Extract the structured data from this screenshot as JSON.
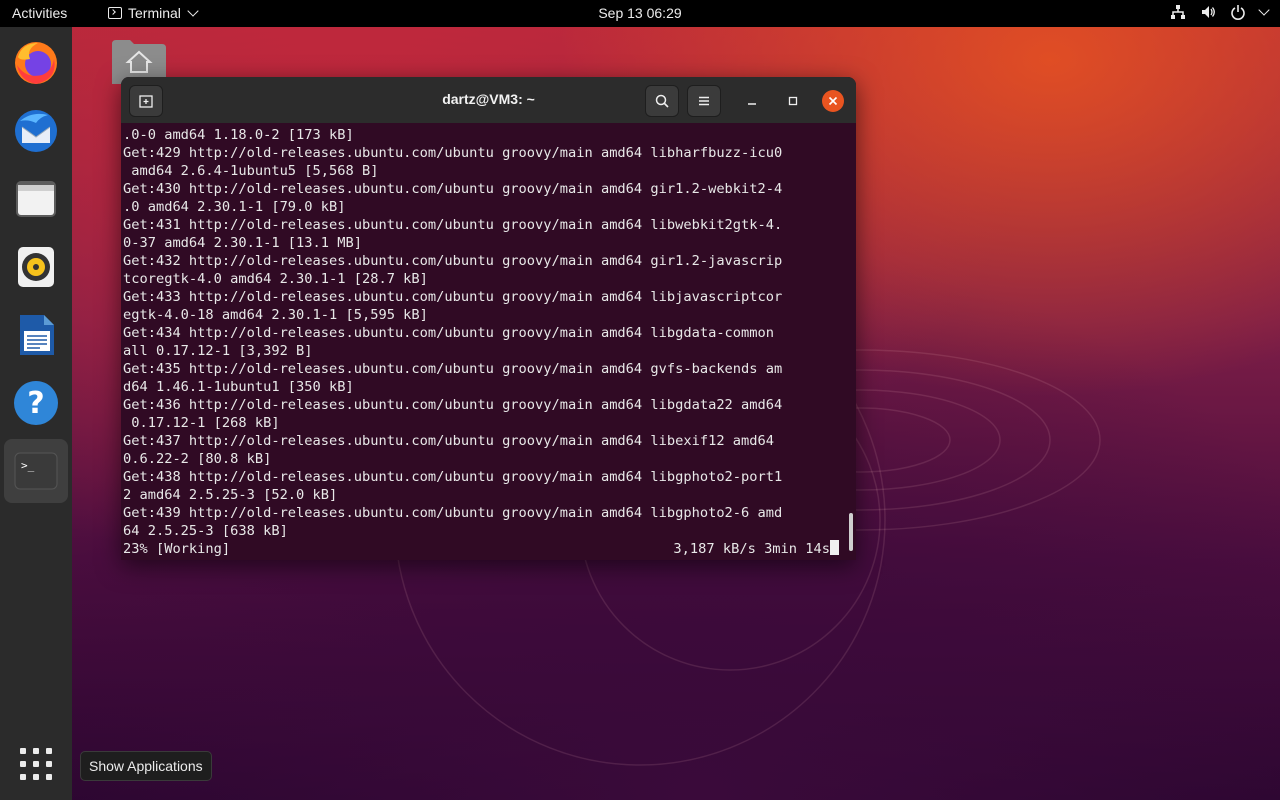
{
  "topbar": {
    "activities": "Activities",
    "app_menu": "Terminal",
    "clock": "Sep 13  06:29"
  },
  "dock": {
    "items": [
      {
        "name": "firefox",
        "icon": "firefox-icon"
      },
      {
        "name": "thunderbird",
        "icon": "thunderbird-icon"
      },
      {
        "name": "files",
        "icon": "files-icon"
      },
      {
        "name": "rhythmbox",
        "icon": "rhythmbox-icon"
      },
      {
        "name": "libreoffice-writer",
        "icon": "writer-icon"
      },
      {
        "name": "help",
        "icon": "help-icon"
      },
      {
        "name": "terminal",
        "icon": "terminal-icon",
        "active": true
      }
    ],
    "show_apps_tooltip": "Show Applications"
  },
  "terminal": {
    "title": "dartz@VM3: ~",
    "lines": [
      ".0-0 amd64 1.18.0-2 [173 kB]",
      "Get:429 http://old-releases.ubuntu.com/ubuntu groovy/main amd64 libharfbuzz-icu0",
      " amd64 2.6.4-1ubuntu5 [5,568 B]",
      "Get:430 http://old-releases.ubuntu.com/ubuntu groovy/main amd64 gir1.2-webkit2-4",
      ".0 amd64 2.30.1-1 [79.0 kB]",
      "Get:431 http://old-releases.ubuntu.com/ubuntu groovy/main amd64 libwebkit2gtk-4.",
      "0-37 amd64 2.30.1-1 [13.1 MB]",
      "Get:432 http://old-releases.ubuntu.com/ubuntu groovy/main amd64 gir1.2-javascrip",
      "tcoregtk-4.0 amd64 2.30.1-1 [28.7 kB]",
      "Get:433 http://old-releases.ubuntu.com/ubuntu groovy/main amd64 libjavascriptcor",
      "egtk-4.0-18 amd64 2.30.1-1 [5,595 kB]",
      "Get:434 http://old-releases.ubuntu.com/ubuntu groovy/main amd64 libgdata-common",
      "all 0.17.12-1 [3,392 B]",
      "Get:435 http://old-releases.ubuntu.com/ubuntu groovy/main amd64 gvfs-backends am",
      "d64 1.46.1-1ubuntu1 [350 kB]",
      "Get:436 http://old-releases.ubuntu.com/ubuntu groovy/main amd64 libgdata22 amd64",
      " 0.17.12-1 [268 kB]",
      "Get:437 http://old-releases.ubuntu.com/ubuntu groovy/main amd64 libexif12 amd64",
      "0.6.22-2 [80.8 kB]",
      "Get:438 http://old-releases.ubuntu.com/ubuntu groovy/main amd64 libgphoto2-port1",
      "2 amd64 2.5.25-3 [52.0 kB]",
      "Get:439 http://old-releases.ubuntu.com/ubuntu groovy/main amd64 libgphoto2-6 amd",
      "64 2.5.25-3 [638 kB]"
    ],
    "status_left": "23% [Working]",
    "status_right": "3,187 kB/s 3min 14s"
  }
}
